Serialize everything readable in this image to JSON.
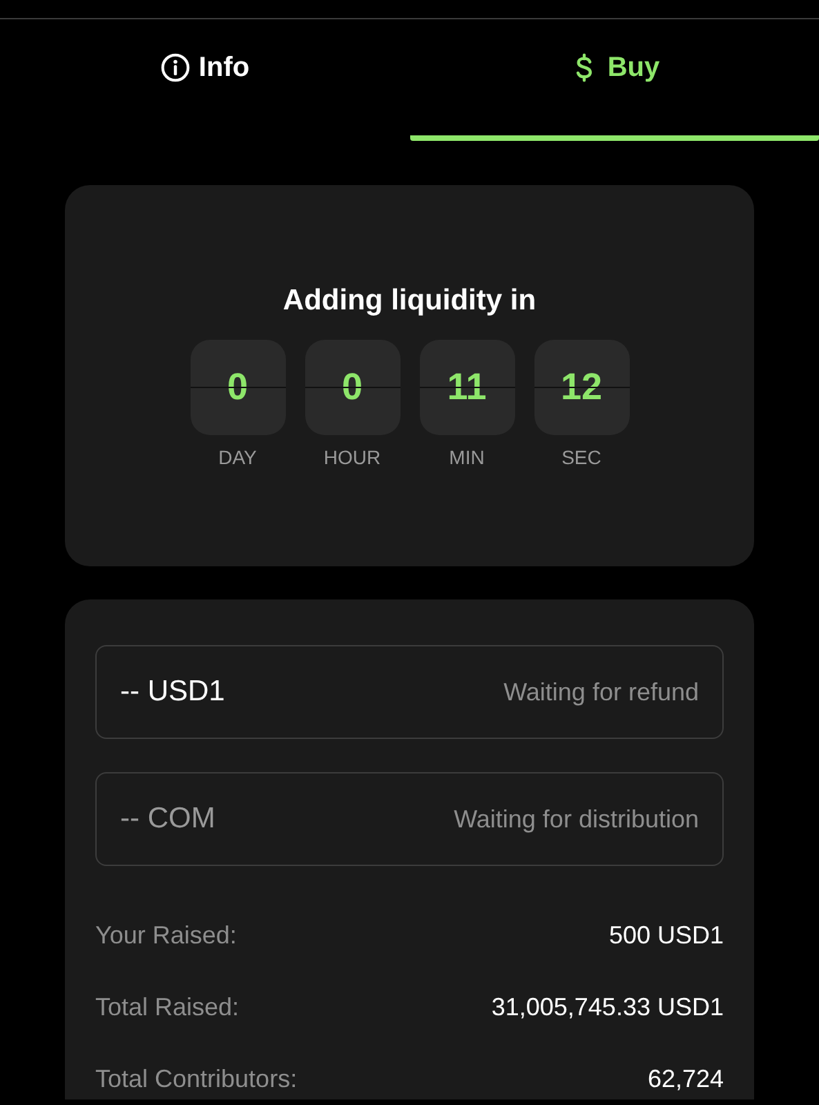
{
  "tabs": [
    {
      "label": "Info",
      "selected": false
    },
    {
      "label": "Buy",
      "selected": true
    }
  ],
  "countdown": {
    "title": "Adding liquidity in",
    "units": [
      {
        "value": "0",
        "label": "DAY"
      },
      {
        "value": "0",
        "label": "HOUR"
      },
      {
        "value": "11",
        "label": "MIN"
      },
      {
        "value": "12",
        "label": "SEC"
      }
    ]
  },
  "balances": [
    {
      "value": "-- USD1",
      "status": "Waiting for refund"
    },
    {
      "value": "-- COM",
      "status": "Waiting for distribution"
    }
  ],
  "stats": [
    {
      "label": "Your Raised:",
      "value": "500 USD1"
    },
    {
      "label": "Total Raised:",
      "value": "31,005,745.33 USD1"
    },
    {
      "label": "Total Contributors:",
      "value": "62,724"
    }
  ]
}
